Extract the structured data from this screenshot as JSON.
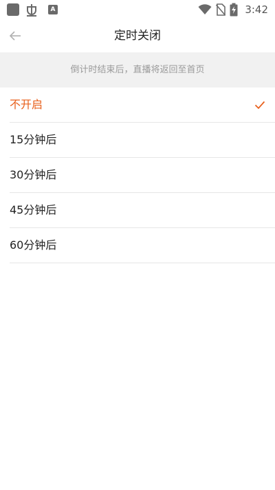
{
  "status_bar": {
    "time": "3:42",
    "icons": [
      "app-square-icon",
      "bug-icon",
      "keyboard-a-icon",
      "wifi-icon",
      "no-sim-icon",
      "battery-charging-icon"
    ]
  },
  "header": {
    "title": "定时关闭",
    "back_icon": "arrow-left-icon"
  },
  "notice": {
    "text": "倒计时结束后，直播将返回至首页"
  },
  "options": [
    {
      "label": "不开启",
      "selected": true
    },
    {
      "label": "15分钟后",
      "selected": false
    },
    {
      "label": "30分钟后",
      "selected": false
    },
    {
      "label": "45分钟后",
      "selected": false
    },
    {
      "label": "60分钟后",
      "selected": false
    }
  ],
  "colors": {
    "accent": "#e8601c",
    "notice_bg": "#f1f1f1",
    "divider": "#e6e6e6"
  }
}
